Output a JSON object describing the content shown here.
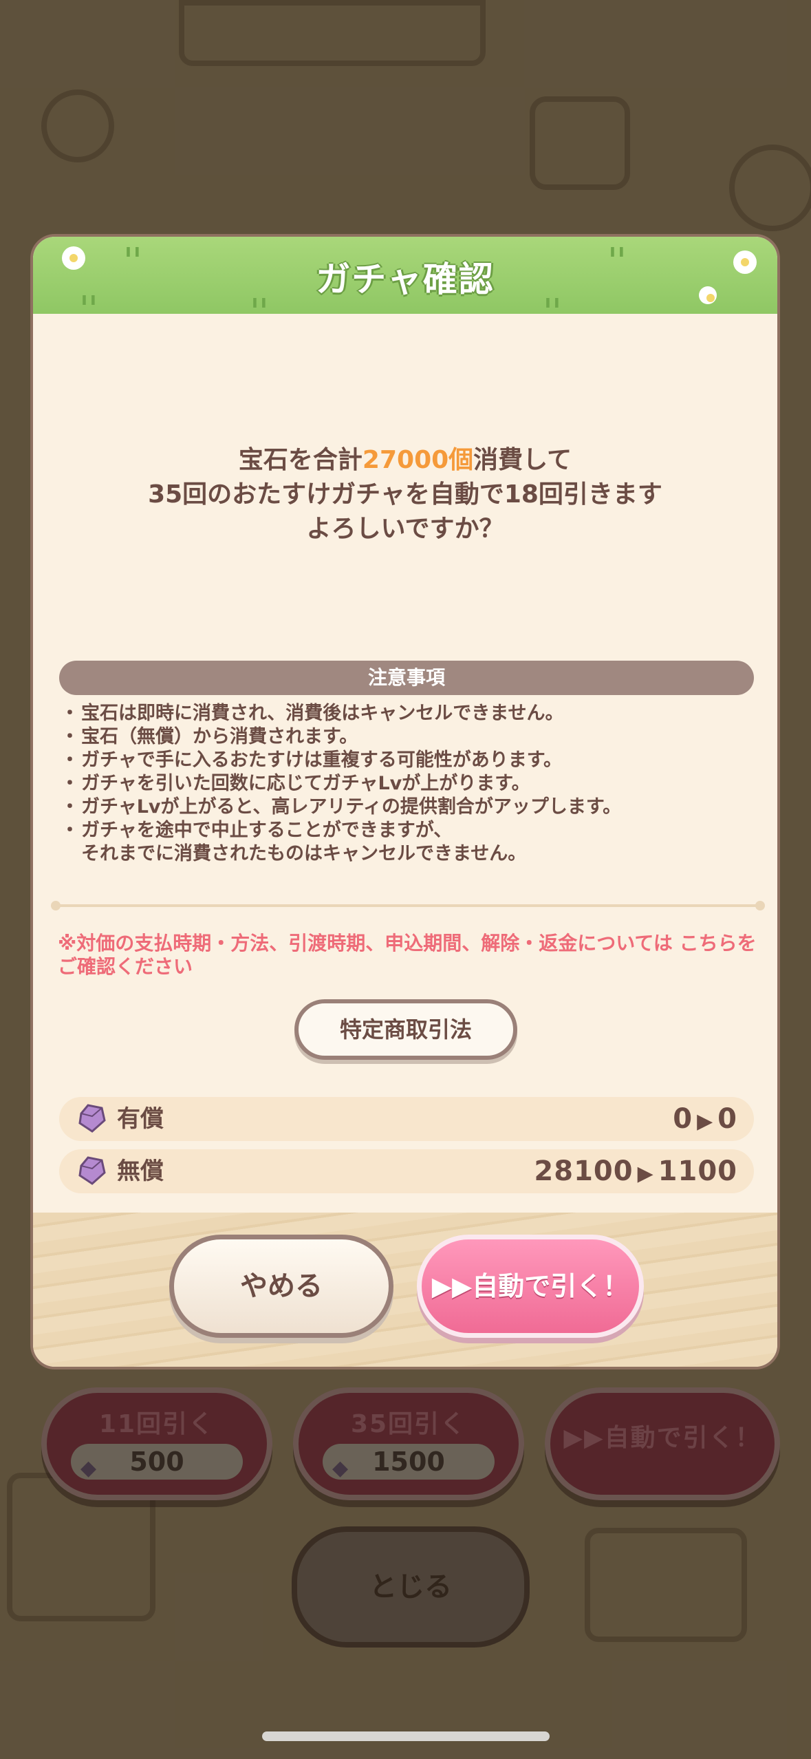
{
  "dialog": {
    "title": "ガチャ確認",
    "message_line1_prefix": "宝石を合計",
    "message_line1_amount": "27000個",
    "message_line1_suffix": "消費して",
    "message_line2": "35回のおたすけガチャを自動で18回引きます",
    "message_line3": "よろしいですか？",
    "notes_header": "注意事項",
    "notes": [
      "宝石は即時に消費され、消費後はキャンセルできません。",
      "宝石（無償）から消費されます。",
      "ガチャで手に入るおたすけは重複する可能性があります。",
      "ガチャを引いた回数に応じてガチャLvが上がります。",
      "ガチャLvが上がると、高レアリティの提供割合がアップします。",
      "ガチャを途中で中止することができますが、",
      "それまでに消費されたものはキャンセルできません。"
    ],
    "legal_notice": "※対価の支払時期・方法、引渡時期、申込期間、解除・返金については こちらをご確認ください",
    "law_button": "特定商取引法",
    "paid_gems": {
      "label": "有償",
      "before": "0",
      "after": "0"
    },
    "free_gems": {
      "label": "無償",
      "before": "28100",
      "after": "1100"
    },
    "cancel_button": "やめる",
    "auto_button": "▶▶自動で引く！"
  },
  "background": {
    "draw11": {
      "label": "11回引く",
      "cost": "500"
    },
    "draw35": {
      "label": "35回引く",
      "cost": "1500"
    },
    "auto_draw": "▶▶自動で引く！",
    "close_button": "とじる"
  },
  "colors": {
    "accent_orange": "#f59a3a",
    "header_green": "#8fc764",
    "auto_pink": "#f06b95",
    "warning_red": "#ee6b78",
    "text_brown": "#6b4c44"
  }
}
